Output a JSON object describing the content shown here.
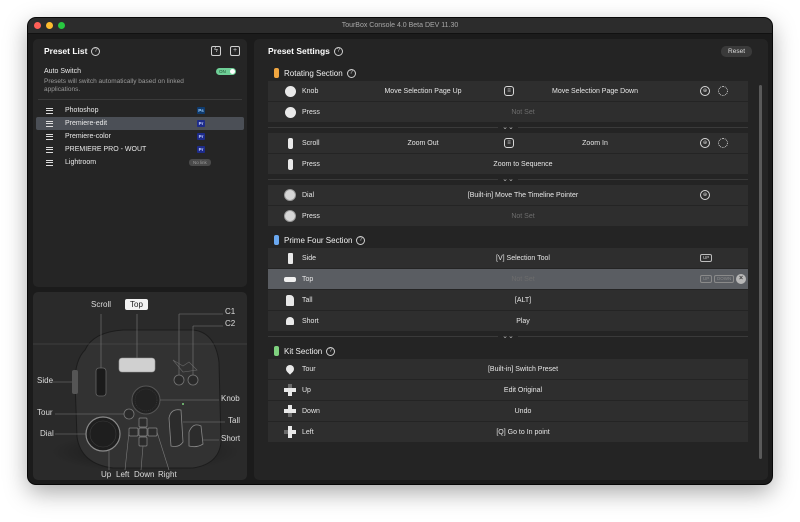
{
  "window": {
    "title": "TourBox Console 4.0 Beta DEV 11.30"
  },
  "preset_list": {
    "title": "Preset List",
    "auto_switch": {
      "label": "Auto Switch",
      "toggle": "ON",
      "description": "Presets will switch automatically based on linked applications."
    },
    "items": [
      {
        "name": "Photoshop",
        "badge": "Ps"
      },
      {
        "name": "Premiere-edit",
        "badge": "Pr",
        "selected": true
      },
      {
        "name": "Premiere-color",
        "badge": "Pr"
      },
      {
        "name": "PREMIERE PRO - WOUT",
        "badge": "Pr"
      },
      {
        "name": "Lightroom",
        "badge": "No link"
      }
    ]
  },
  "device": {
    "labels": {
      "scroll": "Scroll",
      "top": "Top",
      "c1": "C1",
      "c2": "C2",
      "side": "Side",
      "knob": "Knob",
      "tour": "Tour",
      "tall": "Tall",
      "dial": "Dial",
      "short": "Short",
      "up": "Up",
      "left": "Left",
      "down": "Down",
      "right": "Right"
    }
  },
  "settings": {
    "title": "Preset Settings",
    "reset": "Reset",
    "expand_icon": "chevron-double-down-icon",
    "sections": {
      "rotating": {
        "title": "Rotating Section",
        "color": "#f0a640",
        "knob": {
          "label": "Knob",
          "left": "Move Selection Page Up",
          "right": "Move Selection Page Down"
        },
        "knob_press": {
          "label": "Press",
          "action": "Not Set"
        },
        "scroll": {
          "label": "Scroll",
          "left": "Zoom Out",
          "right": "Zoom In"
        },
        "scroll_press": {
          "label": "Press",
          "action": "Zoom to Sequence"
        },
        "dial": {
          "label": "Dial",
          "action": "[Built-in] Move The Timeline Pointer"
        },
        "dial_press": {
          "label": "Press",
          "action": "Not Set"
        }
      },
      "prime": {
        "title": "Prime Four Section",
        "color": "#6aa8f0",
        "side": {
          "label": "Side",
          "action": "[V] Selection Tool",
          "tag": "UP"
        },
        "top": {
          "label": "Top",
          "action": "Not Set",
          "tag1": "UP",
          "tag2": "DOWN"
        },
        "tall": {
          "label": "Tall",
          "action": "[ALT]"
        },
        "short": {
          "label": "Short",
          "action": "Play"
        }
      },
      "kit": {
        "title": "Kit Section",
        "color": "#7ed17e",
        "tour": {
          "label": "Tour",
          "action": "[Built-in] Switch Preset"
        },
        "up": {
          "label": "Up",
          "action": "Edit Original"
        },
        "down": {
          "label": "Down",
          "action": "Undo"
        },
        "left": {
          "label": "Left",
          "action": "[Q] Go to In point"
        }
      }
    }
  }
}
